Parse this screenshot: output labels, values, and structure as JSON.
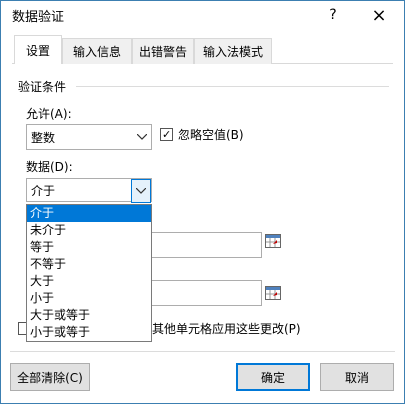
{
  "window": {
    "title": "数据验证",
    "help": "?",
    "close": "×"
  },
  "tabs": [
    {
      "label": "设置",
      "active": true
    },
    {
      "label": "输入信息",
      "active": false
    },
    {
      "label": "出错警告",
      "active": false
    },
    {
      "label": "输入法模式",
      "active": false
    }
  ],
  "settings": {
    "group_title": "验证条件",
    "allow_label": "允许(A):",
    "allow_value": "整数",
    "ignore_blank_label": "忽略空值(B)",
    "ignore_blank_checked": true,
    "data_label": "数据(D):",
    "data_value": "介于",
    "data_options": [
      "介于",
      "未介于",
      "等于",
      "不等于",
      "大于",
      "小于",
      "大于或等于",
      "小于或等于"
    ],
    "data_selected_index": 0,
    "apply_all_partial_label": "其他单元格应用这些更改(P)",
    "apply_all_checked": false
  },
  "buttons": {
    "clear_all": "全部清除(C)",
    "ok": "确定",
    "cancel": "取消"
  },
  "colors": {
    "selection": "#0078d7",
    "border": "#3c7fb1"
  }
}
